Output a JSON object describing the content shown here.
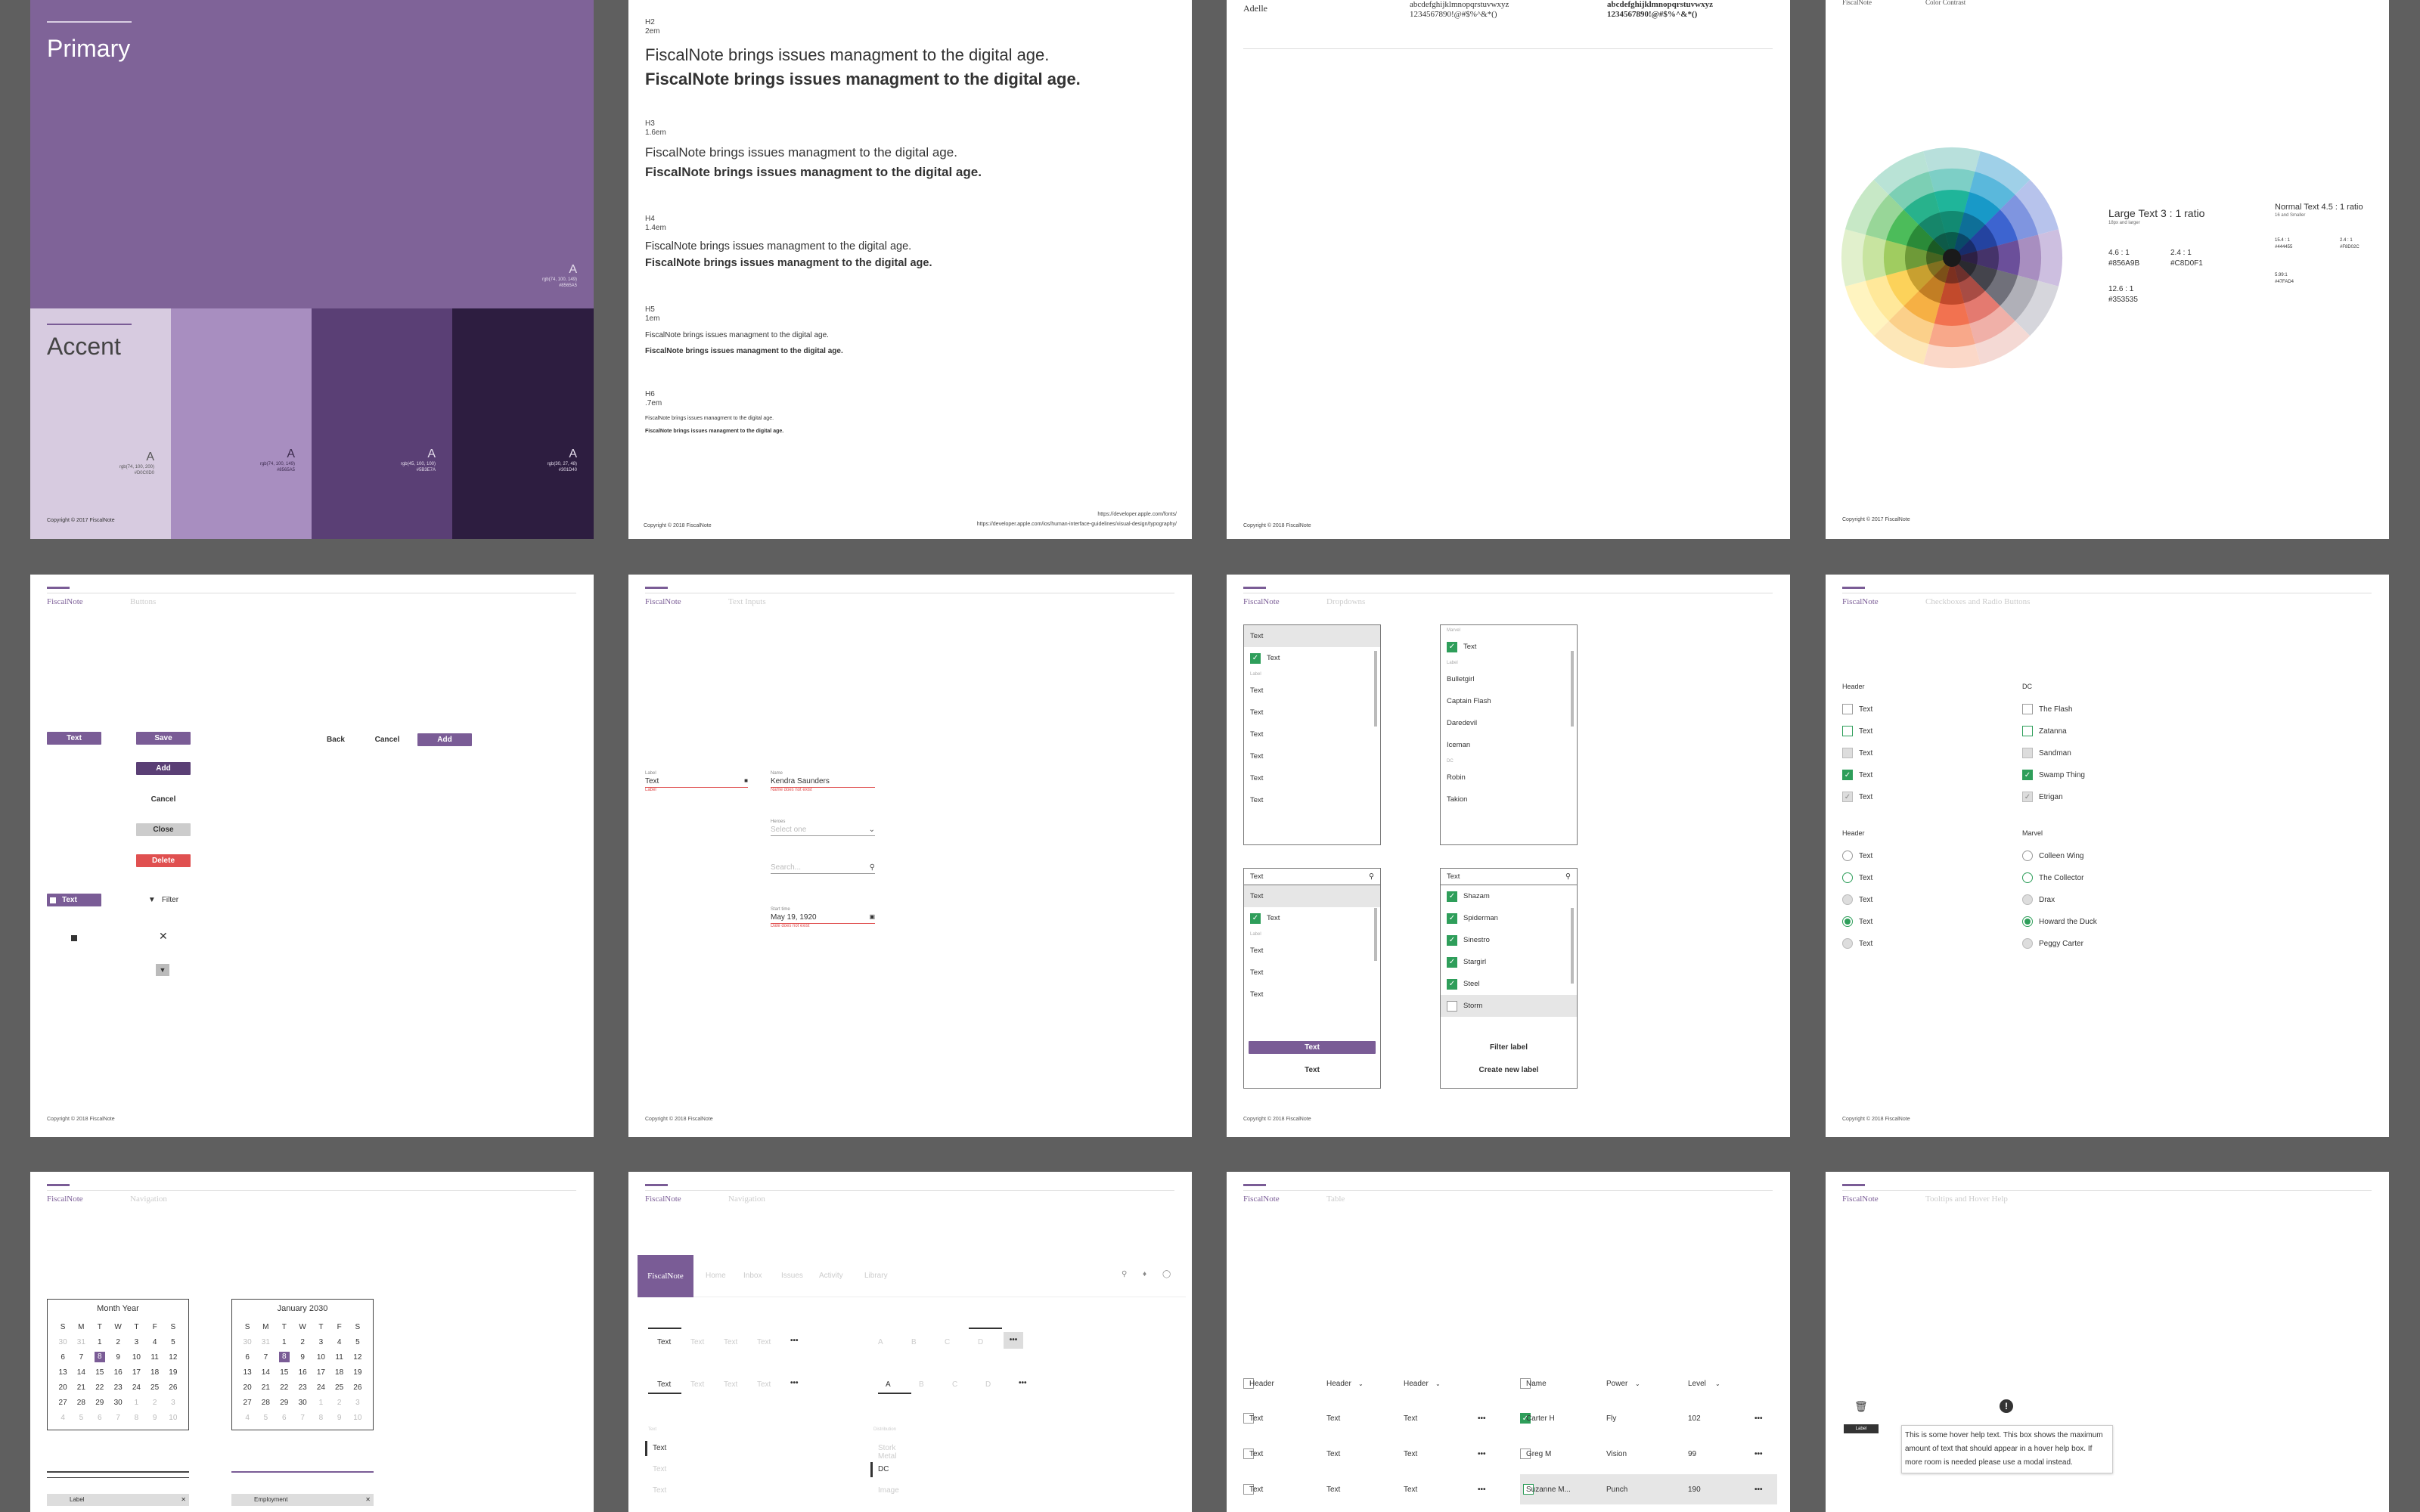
{
  "colors": {
    "primary": "#7a5c96",
    "accent_light": "#d7cbe0",
    "accent_mid": "#a88ec0",
    "accent_dark": "#5a3f75",
    "accent_darker": "#2d1d40",
    "success": "#2e9e5a",
    "danger": "#e05050"
  },
  "card1": {
    "primary_title": "Primary",
    "primary_swatch": {
      "letter": "A",
      "l1": "rgb(74, 100, 149)",
      "l2": "#8565A5"
    },
    "accent_title": "Accent",
    "swatches": [
      {
        "letter": "A",
        "l1": "rgb(74, 100, 200)",
        "l2": "#D0C0D0"
      },
      {
        "letter": "A",
        "l1": "rgb(74, 100, 149)",
        "l2": "#8565A5"
      },
      {
        "letter": "A",
        "l1": "rgb(45, 100, 100)",
        "l2": "#5B3E7A"
      },
      {
        "letter": "A",
        "l1": "rgb(30, 27, 48)",
        "l2": "#301D40"
      }
    ],
    "copyright": "Copyright © 2017 FiscalNote"
  },
  "card2": {
    "sections": [
      {
        "tag": "H2",
        "size": "2em",
        "regular": "FiscalNote brings issues managment to the digital age.",
        "bold": "FiscalNote brings issues managment to the digital age."
      },
      {
        "tag": "H3",
        "size": "1.6em",
        "regular": "FiscalNote brings issues managment to the digital age.",
        "bold": "FiscalNote brings issues managment to the digital age."
      },
      {
        "tag": "H4",
        "size": "1.4em",
        "regular": "FiscalNote brings issues managment to the digital age.",
        "bold": "FiscalNote brings issues managment to the digital age."
      },
      {
        "tag": "H5",
        "size": "1em",
        "regular": "FiscalNote brings issues managment to the digital age.",
        "bold": "FiscalNote brings issues managment to the digital age."
      },
      {
        "tag": "H6",
        "size": ".7em",
        "regular": "FiscalNote brings issues managment to the digital age.",
        "bold": "FiscalNote brings issues managment to the digital age."
      }
    ],
    "link1": "https://developer.apple.com/fonts/",
    "link2": "https://developer.apple.com/ios/human-interface-guidelines/visual-design/typography/",
    "copyright": "Copyright © 2018 FiscalNote"
  },
  "card3": {
    "font": "Adelle",
    "regular_alpha": "abcdefghijklmnopqrstuvwxyz",
    "regular_nums": "1234567890!@#$%^&*()",
    "bold_alpha": "abcdefghijklmnopqrstuvwxyz",
    "bold_nums": "1234567890!@#$%^&*()",
    "copyright": "Copyright © 2018 FiscalNote"
  },
  "card4": {
    "brand": "FiscalNote",
    "section": "Color Contrast",
    "large_title": "Large Text 3 : 1 ratio",
    "large_sub": "18px and larger",
    "large_items": [
      {
        "r": "4.6 : 1",
        "c": "#856A9B"
      },
      {
        "r": "2.4 : 1",
        "c": "#C8D0F1"
      },
      {
        "r": "12.6 : 1",
        "c": "#353535"
      }
    ],
    "normal_title": "Normal Text 4.5 : 1 ratio",
    "normal_sub": "16 and Smaller",
    "normal_items": [
      {
        "r": "15.4 : 1",
        "c": "#444455"
      },
      {
        "r": "2.4 : 1",
        "c": "#F8D02C"
      },
      {
        "r": "5.99:1",
        "c": "#47FAD4"
      }
    ],
    "copyright": "Copyright © 2017 FiscalNote"
  },
  "card5": {
    "brand": "FiscalNote",
    "section": "Buttons",
    "buttons": {
      "text": "Text",
      "save": "Save",
      "add": "Add",
      "cancel": "Cancel",
      "close": "Close",
      "delete": "Delete",
      "back": "Back",
      "cancel2": "Cancel",
      "add2": "Add",
      "icon_text": "Text",
      "filter": "Filter"
    },
    "copyright": "Copyright © 2018 FiscalNote"
  },
  "card6": {
    "brand": "FiscalNote",
    "section": "Text Inputs",
    "f1": {
      "label": "Label",
      "value": "Text",
      "error": "Label"
    },
    "f2": {
      "label": "Name",
      "value": "Kendra Saunders",
      "error": "Name does not exist"
    },
    "f3": {
      "label": "Heroes",
      "placeholder": "Select one"
    },
    "f4": {
      "placeholder": "Search..."
    },
    "f5": {
      "label": "Start time",
      "value": "May 19, 1920",
      "error": "Date does not exist"
    },
    "copyright": "Copyright © 2018 FiscalNote"
  },
  "card7": {
    "brand": "FiscalNote",
    "section": "Dropdowns",
    "dd1": [
      "Text",
      "Text",
      "Label",
      "Text",
      "Text",
      "Text",
      "Text",
      "Text",
      "Text",
      "Text"
    ],
    "dd2": [
      "Marvel",
      "Text",
      "Label",
      "Bulletgirl",
      "Captain Flash",
      "Daredevil",
      "Iceman",
      "DC",
      "Robin",
      "Takion"
    ],
    "dd3": {
      "search": "Text",
      "items": [
        "Text",
        "Text",
        "Label",
        "Text",
        "Text",
        "Text"
      ],
      "primary": "Text",
      "secondary": "Text"
    },
    "dd4": {
      "search": "Text",
      "items": [
        "Shazam",
        "Spiderman",
        "Sinestro",
        "Stargirl",
        "Steel",
        "Storm"
      ],
      "a1": "Filter label",
      "a2": "Create new label"
    },
    "copyright": "Copyright © 2018 FiscalNote"
  },
  "card8": {
    "brand": "FiscalNote",
    "section": "Checkboxes and Radio Buttons",
    "h1": "Header",
    "dc": "DC",
    "h2": "Header",
    "marvel": "Marvel",
    "col1_text": "Text",
    "dc_items": [
      "The Flash",
      "Zatanna",
      "Sandman",
      "Swamp Thing",
      "Etrigan"
    ],
    "marvel_items": [
      "Colleen Wing",
      "The Collector",
      "Drax",
      "Howard the Duck",
      "Peggy Carter"
    ],
    "copyright": "Copyright © 2018 FiscalNote"
  },
  "card9": {
    "brand": "FiscalNote",
    "section": "Navigation",
    "cal1": {
      "title": "Month Year",
      "days": [
        "S",
        "M",
        "T",
        "W",
        "T",
        "F",
        "S"
      ],
      "rows": [
        [
          "30",
          "31",
          "1",
          "2",
          "3",
          "4",
          "5"
        ],
        [
          "6",
          "7",
          "8",
          "9",
          "10",
          "11",
          "12"
        ],
        [
          "13",
          "14",
          "15",
          "16",
          "17",
          "18",
          "19"
        ],
        [
          "20",
          "21",
          "22",
          "23",
          "24",
          "25",
          "26"
        ],
        [
          "27",
          "28",
          "29",
          "30",
          "1",
          "2",
          "3"
        ],
        [
          "4",
          "5",
          "6",
          "7",
          "8",
          "9",
          "10"
        ]
      ]
    },
    "cal2": {
      "title": "January 2030",
      "days": [
        "S",
        "M",
        "T",
        "W",
        "T",
        "F",
        "S"
      ],
      "rows": [
        [
          "30",
          "31",
          "1",
          "2",
          "3",
          "4",
          "5"
        ],
        [
          "6",
          "7",
          "8",
          "9",
          "10",
          "11",
          "12"
        ],
        [
          "13",
          "14",
          "15",
          "16",
          "17",
          "18",
          "19"
        ],
        [
          "20",
          "21",
          "22",
          "23",
          "24",
          "25",
          "26"
        ],
        [
          "27",
          "28",
          "29",
          "30",
          "1",
          "2",
          "3"
        ],
        [
          "4",
          "5",
          "6",
          "7",
          "8",
          "9",
          "10"
        ]
      ]
    },
    "b1": "Label",
    "b2": "Employment"
  },
  "card10": {
    "brand": "FiscalNote",
    "section": "Navigation",
    "nav": {
      "brand": "FiscalNote",
      "items": [
        "Home",
        "Inbox",
        "Issues",
        "Activity",
        "Library"
      ]
    },
    "tabs": [
      "Text",
      "Text",
      "Text",
      "Text"
    ],
    "letters": [
      "A",
      "B",
      "C",
      "D"
    ],
    "side": [
      "Text",
      "Text",
      "Text",
      "Text"
    ],
    "side2": {
      "label": "Distribution",
      "items": [
        "Stork Metal",
        "DC",
        "Image"
      ]
    }
  },
  "card11": {
    "brand": "FiscalNote",
    "section": "Table",
    "h": [
      "Header",
      "Header",
      "Header"
    ],
    "h2": [
      "Name",
      "Power",
      "Level"
    ],
    "rows": [
      [
        "Text",
        "Text",
        "Text"
      ],
      [
        "Text",
        "Text",
        "Text"
      ],
      [
        "Text",
        "Text",
        "Text"
      ]
    ],
    "rows2": [
      [
        "Carter H",
        "Fly",
        "102"
      ],
      [
        "Greg M",
        "Vision",
        "99"
      ],
      [
        "Suzanne M...",
        "Punch",
        "190"
      ]
    ]
  },
  "card12": {
    "brand": "FiscalNote",
    "section": "Tooltips and Hover Help",
    "label": "Label",
    "tip": "This is some hover help text. This box shows the maximum amount of text that should appear in a hover help box. If more room is needed please use a modal instead."
  }
}
